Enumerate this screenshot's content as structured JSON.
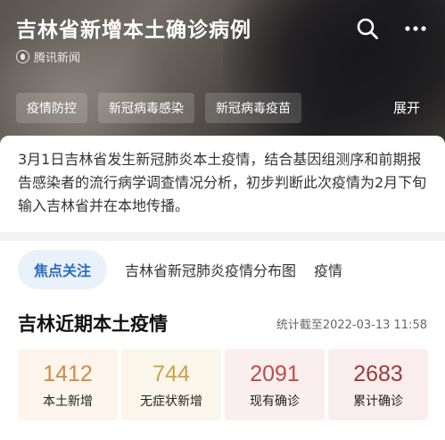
{
  "header": {
    "title": "吉林省新增本土确诊病例",
    "source": "腾讯新闻",
    "source_icon": "tencent-news-logo-icon",
    "tags": [
      "疫情防控",
      "新冠病毒感染",
      "新冠病毒疫苗"
    ],
    "expand_label": "展开",
    "actions": [
      "search-icon",
      "more-icon"
    ]
  },
  "summary": {
    "text": "3月1日吉林省发生新冠肺炎本土疫情，结合基因组测序和前期报告感染者的流行病学调查情况分析，初步判断此次疫情为2月下旬输入吉林省并在本地传播。"
  },
  "focus": {
    "pill": "焦点关注",
    "links": [
      "吉林省新冠肺炎疫情分布图",
      "疫情"
    ]
  },
  "section": {
    "title": "吉林近期本土疫情",
    "timestamp": "统计截至2022-03-13 11:58"
  },
  "stats": [
    {
      "value": "1412",
      "label": "本土新增",
      "color": "#d28a4a"
    },
    {
      "value": "744",
      "label": "无症状新增",
      "color": "#c9a24a"
    },
    {
      "value": "2091",
      "label": "现有确诊",
      "color": "#c34a4a"
    },
    {
      "value": "2683",
      "label": "累计确诊",
      "color": "#9e3a3a"
    }
  ]
}
